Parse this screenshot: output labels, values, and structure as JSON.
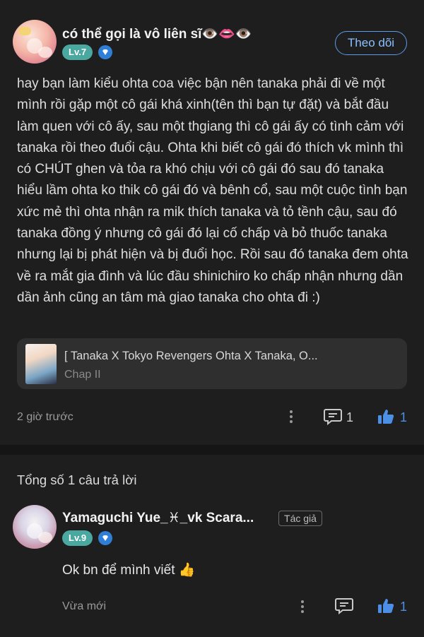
{
  "post": {
    "author": "có thể gọi là vô liên sĩ👁️👄👁️",
    "level": "Lv.7",
    "follow_label": "Theo dõi",
    "body": "hay bạn làm kiểu ohta coa việc bận nên tanaka phải đi về một mình rồi gặp một cô gái khá xinh(tên thì bạn tự đặt) và bắt đầu làm quen với cô ấy, sau một thgiang thì cô gái ấy có tình cảm với tanaka rồi theo đuổi cậu. Ohta khi biết cô gái đó thích vk mình thì có CHÚT ghen và tỏa ra khó chịu với cô gái đó sau đó tanaka hiểu lầm ohta ko thik cô gái đó và bênh cổ, sau một cuộc tình bạn xức mẻ thì ohta nhận ra mik thích tanaka và tỏ tềnh cậu, sau đó tanaka đồng ý nhưng cô gái đó lại cố chấp và bỏ thuốc tanaka nhưng lại bị phát hiện và bị đuổi học. Rồi sau đó tanaka đem ohta về ra mắt gia đình và lúc đầu shinichiro ko chấp nhận nhưng dần dần ảnh cũng an tâm mà giao tanaka cho ohta đi :)",
    "card": {
      "title": "[ Tanaka X Tokyo Revengers Ohta X Tanaka, O...",
      "subtitle": "Chap II"
    },
    "time": "2 giờ trước",
    "comment_count": "1",
    "like_count": "1"
  },
  "replies": {
    "total_label": "Tổng số 1 câu trả lời",
    "items": [
      {
        "author": "Yamaguchi Yue_♓_vk Scara...",
        "level": "Lv.9",
        "author_tag": "Tác giả",
        "text": "Ok bn để mình viết 👍",
        "time": "Vừa mới",
        "like_count": "1"
      }
    ]
  },
  "colors": {
    "background": "#1e1e1e",
    "accent_blue": "#4c8fe6",
    "level_badge": "#4aa8a0"
  }
}
